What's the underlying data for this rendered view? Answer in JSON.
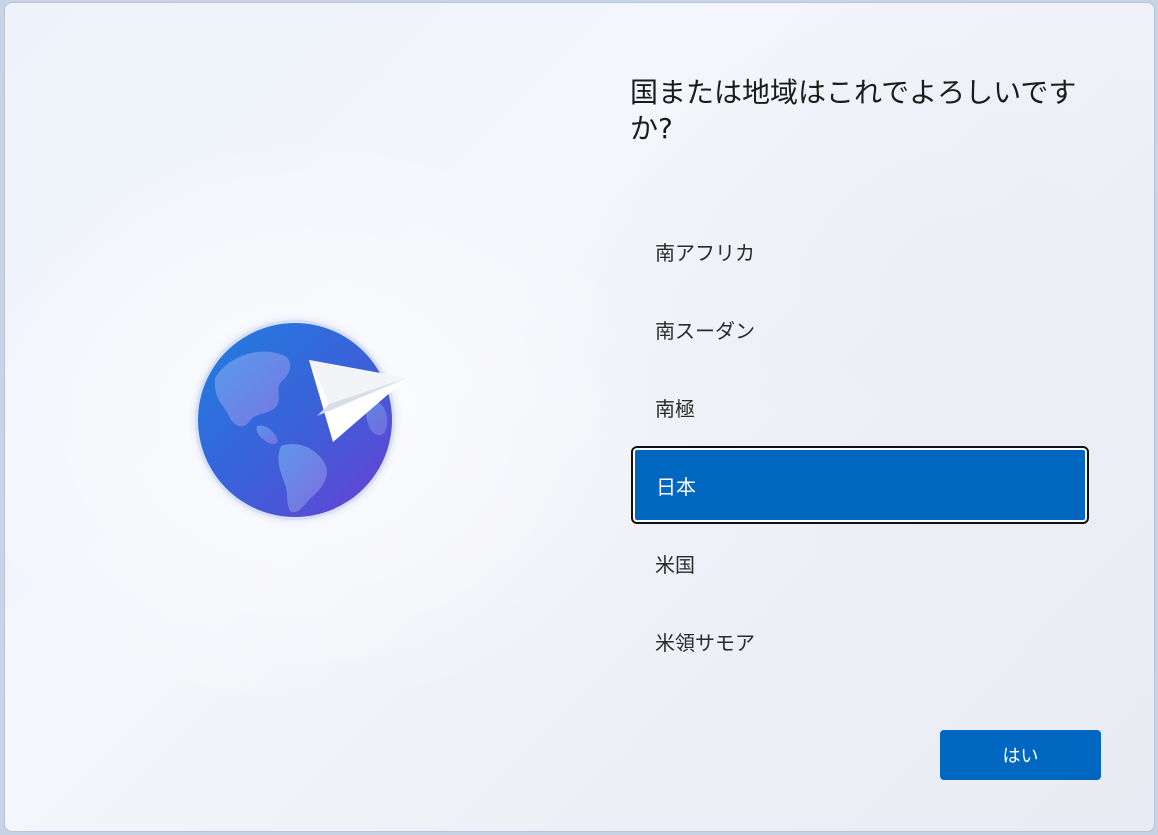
{
  "page": {
    "title": "国または地域はこれでよろしいですか?"
  },
  "regions": {
    "items": [
      {
        "label": "南アフリカ",
        "selected": false
      },
      {
        "label": "南スーダン",
        "selected": false
      },
      {
        "label": "南極",
        "selected": false
      },
      {
        "label": "日本",
        "selected": true
      },
      {
        "label": "米国",
        "selected": false
      },
      {
        "label": "米領サモア",
        "selected": false
      }
    ]
  },
  "actions": {
    "yes_label": "はい"
  },
  "illustration": {
    "icon": "globe-with-paper-plane-icon"
  },
  "colors": {
    "accent": "#0067c0",
    "selected_text": "#ffffff",
    "text": "#1b1b1b"
  }
}
